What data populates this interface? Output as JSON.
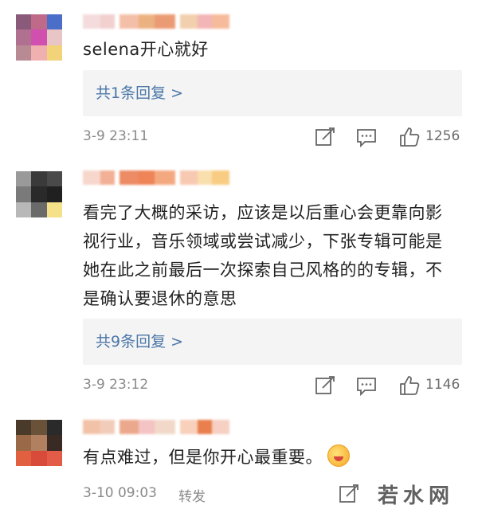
{
  "comments": [
    {
      "text": "selena开心就好",
      "reply": "共1条回复 >",
      "time": "3-9 23:11",
      "likes": "1256",
      "avatar_colors": [
        "#8a5a7a",
        "#c06a8a",
        "#4b6fc8",
        "#b07090",
        "#d14fae",
        "#e8c6c6",
        "#b88a94",
        "#f0b0b0",
        "#f2d37a"
      ],
      "name_blur_colors": [
        "#f3d6d6",
        "#f0c8c8",
        "#f3b49a",
        "#e9a46b",
        "#e88a5c",
        "#f0c7a0",
        "#f2a9a9",
        "#f5b08a"
      ]
    },
    {
      "text": "看完了大概的采访，应该是以后重心会更靠向影视行业，音乐领域或尝试减少，下张专辑可能是她在此之前最后一次探索自己风格的的专辑，不是确认要退休的意思",
      "reply": "共9条回复 >",
      "time": "3-9 23:12",
      "likes": "1146",
      "avatar_colors": [
        "#9a9a9a",
        "#3a3a3a",
        "#4a4a4a",
        "#7a7a7a",
        "#2a2a2a",
        "#202020",
        "#b8b8b8",
        "#6a6a6a",
        "#f4e18a"
      ],
      "name_blur_colors": [
        "#f6d0c4",
        "#f0a384",
        "#e9774a",
        "#ec6f3a",
        "#f29a6a",
        "#f7c0a4",
        "#f8d9a0",
        "#f7c46d"
      ]
    },
    {
      "text": "有点难过，但是你开心最重要。",
      "time": "3-10 09:03",
      "forward": "转发",
      "avatar_colors": [
        "#4a3a2a",
        "#6a5238",
        "#2a2a2a",
        "#9a6a48",
        "#b08060",
        "#3a2a24",
        "#e06040",
        "#d84a3a",
        "#e25c48"
      ],
      "name_blur_colors": [
        "#f0b89a",
        "#f0c4b0",
        "#e99a78",
        "#f3b9b9",
        "#f0d2c0",
        "#f7c8b0",
        "#e6692f",
        "#f5c8b8"
      ]
    }
  ],
  "watermark": "若水网",
  "icons": {
    "forward": "edit-share-icon",
    "comment": "comment-icon",
    "like": "thumbs-up-icon"
  }
}
